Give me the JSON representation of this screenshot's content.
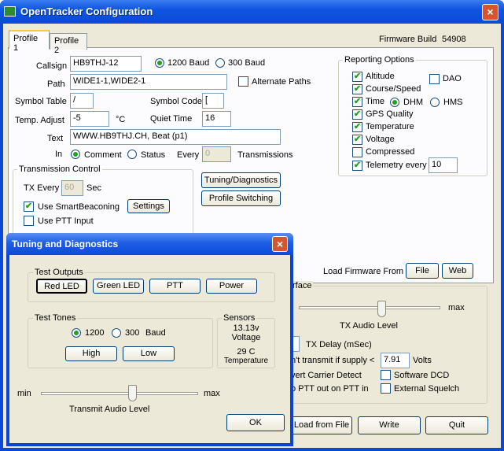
{
  "window": {
    "title": "OpenTracker Configuration",
    "close": "×"
  },
  "tabs": [
    "Profile 1",
    "Profile 2"
  ],
  "firmware_build": {
    "label": "Firmware Build",
    "value": "54908"
  },
  "profile": {
    "callsign_label": "Callsign",
    "callsign": "HB9THJ-12",
    "baud_1200": "1200 Baud",
    "baud_300": "300 Baud",
    "path_label": "Path",
    "path": "WIDE1-1,WIDE2-1",
    "alt_paths": "Alternate Paths",
    "symtable_label": "Symbol Table",
    "symtable": "/",
    "symcode_label": "Symbol Code",
    "symcode": "[",
    "temp_label": "Temp. Adjust",
    "temp": "-5",
    "temp_unit": "°C",
    "quiet_label": "Quiet Time",
    "quiet": "16",
    "text_label": "Text",
    "text": "WWW.HB9THJ.CH, Beat (p1)",
    "in_label": "In",
    "comment": "Comment",
    "status": "Status",
    "every_label": "Every",
    "every": "0",
    "transmissions": "Transmissions"
  },
  "transmission": {
    "title": "Transmission Control",
    "tx_every_label": "TX Every",
    "tx_every": "60",
    "sec": "Sec",
    "smartbeacon": "Use SmartBeaconing",
    "settings": "Settings",
    "ptt_input": "Use PTT Input"
  },
  "reporting": {
    "title": "Reporting Options",
    "altitude": "Altitude",
    "dao": "DAO",
    "course": "Course/Speed",
    "time": "Time",
    "dhm": "DHM",
    "hms": "HMS",
    "gps": "GPS Quality",
    "temperature": "Temperature",
    "voltage": "Voltage",
    "compressed": "Compressed",
    "telemetry": "Telemetry every",
    "telemetry_val": "10"
  },
  "buttons": {
    "tuning": "Tuning/Diagnostics",
    "profile_switching": "Profile Switching",
    "load_firmware": "Load Firmware From",
    "file": "File",
    "web": "Web",
    "load_from_file": "Load from File",
    "write": "Write",
    "quit": "Quit"
  },
  "radio": {
    "interface": "rface",
    "max": "max",
    "tx_audio": "TX Audio Level",
    "tx_delay": "TX Delay (mSec)",
    "no_tx_supply": "n't transmit if supply <",
    "supply": "7.91",
    "volts": "Volts",
    "invert_carrier": "vert Carrier Detect",
    "software_dcd": "Software DCD",
    "ptt_out": "o PTT out on PTT in",
    "ext_squelch": "External Squelch"
  },
  "dialog": {
    "title": "Tuning and Diagnostics",
    "outputs_title": "Test Outputs",
    "outputs": [
      "Red LED",
      "Green LED",
      "PTT",
      "Power"
    ],
    "tones_title": "Test Tones",
    "t1200": "1200",
    "t300": "300",
    "baud": "Baud",
    "high": "High",
    "low": "Low",
    "sensors_title": "Sensors",
    "voltage_val": "13.13v",
    "voltage_label": "Voltage",
    "temp_val": "29 C",
    "temp_label": "Temperature",
    "min": "min",
    "max": "max",
    "tx_audio": "Transmit Audio Level",
    "ok": "OK"
  },
  "colors": {
    "titlebar": "#0a4ad6",
    "face": "#ece9d8",
    "check": "#21a121"
  }
}
